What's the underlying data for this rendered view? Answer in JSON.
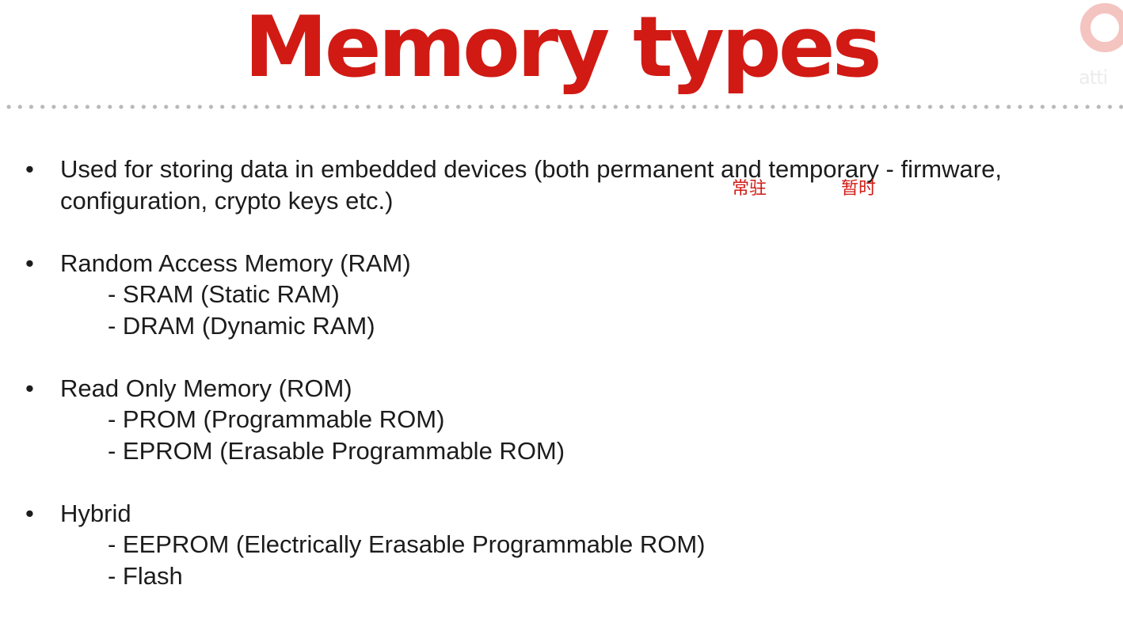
{
  "slide": {
    "title": "Memory types",
    "title_color": "#d11a14",
    "text_color": "#1c1c1c",
    "bullet_glyph": "•",
    "bullets": [
      {
        "lines": [
          "Used for storing data in embedded devices (both permanent and temporary - firmware,",
          "configuration, crypto keys etc.)"
        ],
        "subitems": []
      },
      {
        "lines": [
          "Random Access Memory (RAM)"
        ],
        "subitems": [
          "- SRAM (Static RAM)",
          "- DRAM (Dynamic RAM)"
        ]
      },
      {
        "lines": [
          "Read Only Memory (ROM)"
        ],
        "subitems": [
          "- PROM (Programmable ROM)",
          "- EPROM (Erasable Programmable ROM)"
        ]
      },
      {
        "lines": [
          "Hybrid"
        ],
        "subitems": [
          "- EEPROM (Electrically Erasable Programmable ROM)",
          "- Flash"
        ]
      }
    ]
  },
  "annotations": {
    "color": "#d11a14",
    "permanent": "常驻",
    "temporary": "暂时"
  },
  "logo": {
    "text": "atti",
    "icon": "logo-ring-icon"
  }
}
